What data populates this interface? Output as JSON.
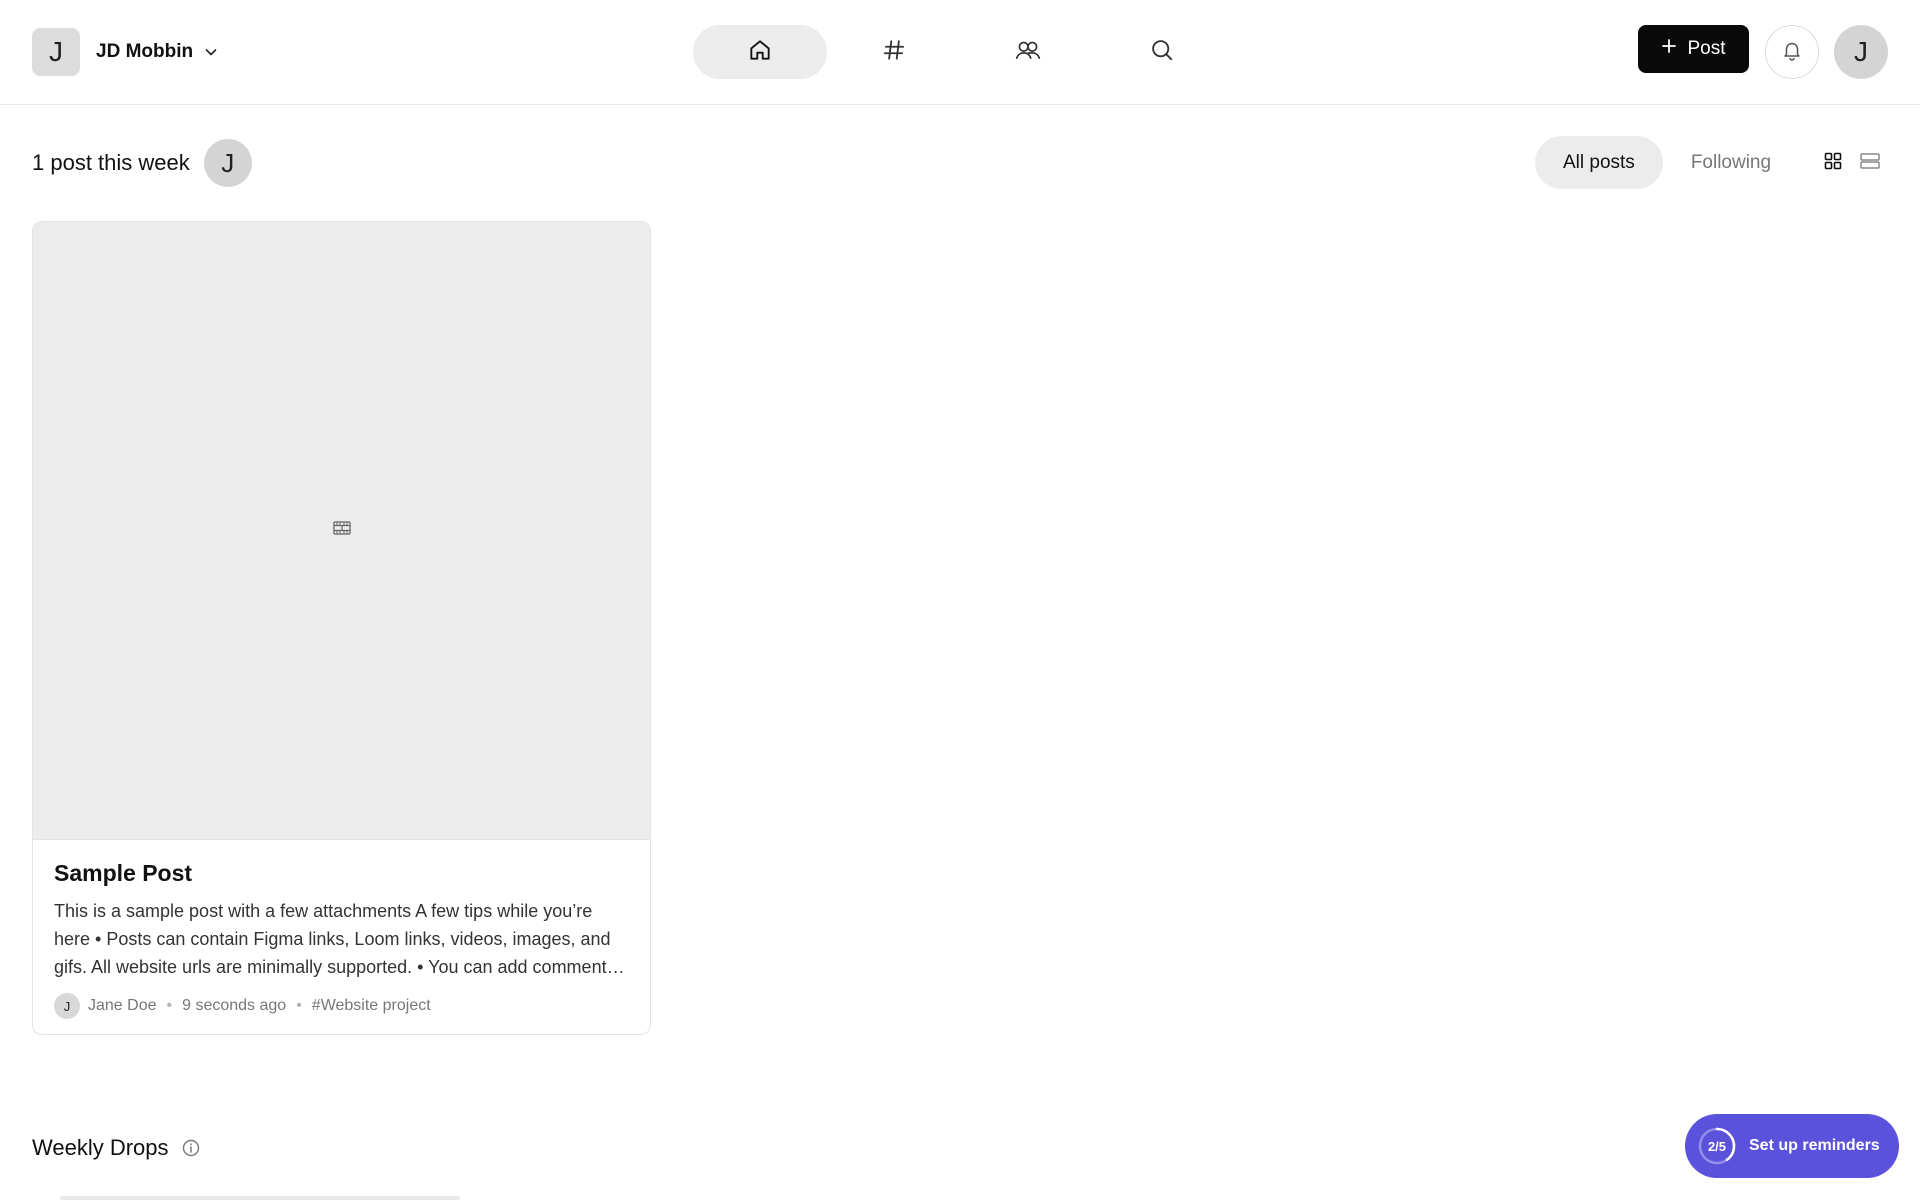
{
  "colors": {
    "accent": "#5b52dc",
    "post_button": "#0a0a0a",
    "nav_active_bg": "#ececec",
    "card_media_bg": "#ececec"
  },
  "header": {
    "workspace": {
      "avatar_letter": "J",
      "name": "JD Mobbin",
      "icon": "chevron-down-icon"
    },
    "nav": [
      {
        "id": "home",
        "icon": "home-icon",
        "active": true
      },
      {
        "id": "channels",
        "icon": "hash-icon",
        "active": false
      },
      {
        "id": "people",
        "icon": "people-icon",
        "active": false
      },
      {
        "id": "search",
        "icon": "search-icon",
        "active": false
      }
    ],
    "post_button": {
      "icon": "plus-icon",
      "label": "Post"
    },
    "notifications": {
      "icon": "bell-icon"
    },
    "user_avatar_letter": "J"
  },
  "feed": {
    "summary": "1 post this week",
    "summary_avatar_letter": "J",
    "filters": [
      {
        "label": "All posts",
        "active": true
      },
      {
        "label": "Following",
        "active": false
      }
    ],
    "views": [
      {
        "icon": "grid-view-icon",
        "active": true
      },
      {
        "icon": "list-view-icon",
        "active": false
      }
    ]
  },
  "post": {
    "media_icon": "film-strip-icon",
    "title": "Sample Post",
    "excerpt": "This is a sample post with a few attachments A few tips while you’re here • Posts can contain Figma links, Loom links, videos, images, and gifs. All website urls are minimally supported. • You can add comments and reactions to any attachment.",
    "author_letter": "J",
    "author": "Jane Doe",
    "time": "9 seconds ago",
    "project": "#Website project"
  },
  "weekly_drops": {
    "title": "Weekly Drops",
    "icon": "info-icon"
  },
  "reminders": {
    "progress_label": "2/5",
    "progress_value": 0.4,
    "label": "Set up reminders"
  }
}
